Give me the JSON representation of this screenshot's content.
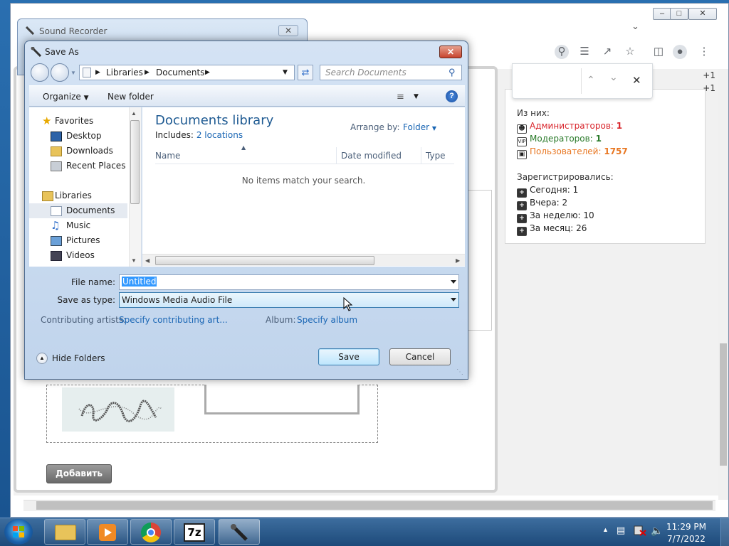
{
  "browser": {
    "find_prev": "⌃",
    "find_next": "⌄",
    "find_close": "✕",
    "plus_counts": [
      "+1",
      "+1"
    ],
    "side_panel": {
      "from_them": "Из них:",
      "admins_label": "Администраторов:",
      "admins_count": "1",
      "mods_label": "Модераторов:",
      "mods_count": "1",
      "users_label": "Пользователей:",
      "users_count": "1757",
      "registered": "Зарегистрировались:",
      "today_label": "Сегодня:",
      "today_count": "1",
      "yesterday_label": "Вчера:",
      "yesterday_count": "2",
      "week_label": "За неделю:",
      "week_count": "10",
      "month_label": "За месяц:",
      "month_count": "26",
      "colors": {
        "admin": "#d8232a",
        "mod": "#2a7a2a",
        "user": "#e87722"
      }
    },
    "captcha_text": "da9a4g",
    "add_button": "Добавить"
  },
  "sound_recorder": {
    "title": "Sound Recorder"
  },
  "dialog": {
    "title": "Save As",
    "address": {
      "part1": "Libraries",
      "part2": "Documents"
    },
    "search_placeholder": "Search Documents",
    "organize": "Organize",
    "new_folder": "New folder",
    "help": "?",
    "nav": {
      "favorites": "Favorites",
      "desktop": "Desktop",
      "downloads": "Downloads",
      "recent": "Recent Places",
      "libraries": "Libraries",
      "documents": "Documents",
      "music": "Music",
      "pictures": "Pictures",
      "videos": "Videos"
    },
    "library_title": "Documents library",
    "includes_label": "Includes:",
    "includes_link": "2 locations",
    "arrange_label": "Arrange by:",
    "arrange_value": "Folder",
    "columns": {
      "name": "Name",
      "date": "Date modified",
      "type": "Type"
    },
    "empty_message": "No items match your search.",
    "file_name_label": "File name:",
    "file_name_value": "Untitled",
    "save_type_label": "Save as type:",
    "save_type_value": "Windows Media Audio File",
    "artists_label": "Contributing artists:",
    "artists_value": "Specify contributing art...",
    "album_label": "Album:",
    "album_value": "Specify album",
    "hide_folders": "Hide Folders",
    "save": "Save",
    "cancel": "Cancel",
    "link_color": "#1a66b4"
  },
  "taskbar": {
    "time": "11:29 PM",
    "date": "7/7/2022",
    "app_7zip": "7z"
  }
}
